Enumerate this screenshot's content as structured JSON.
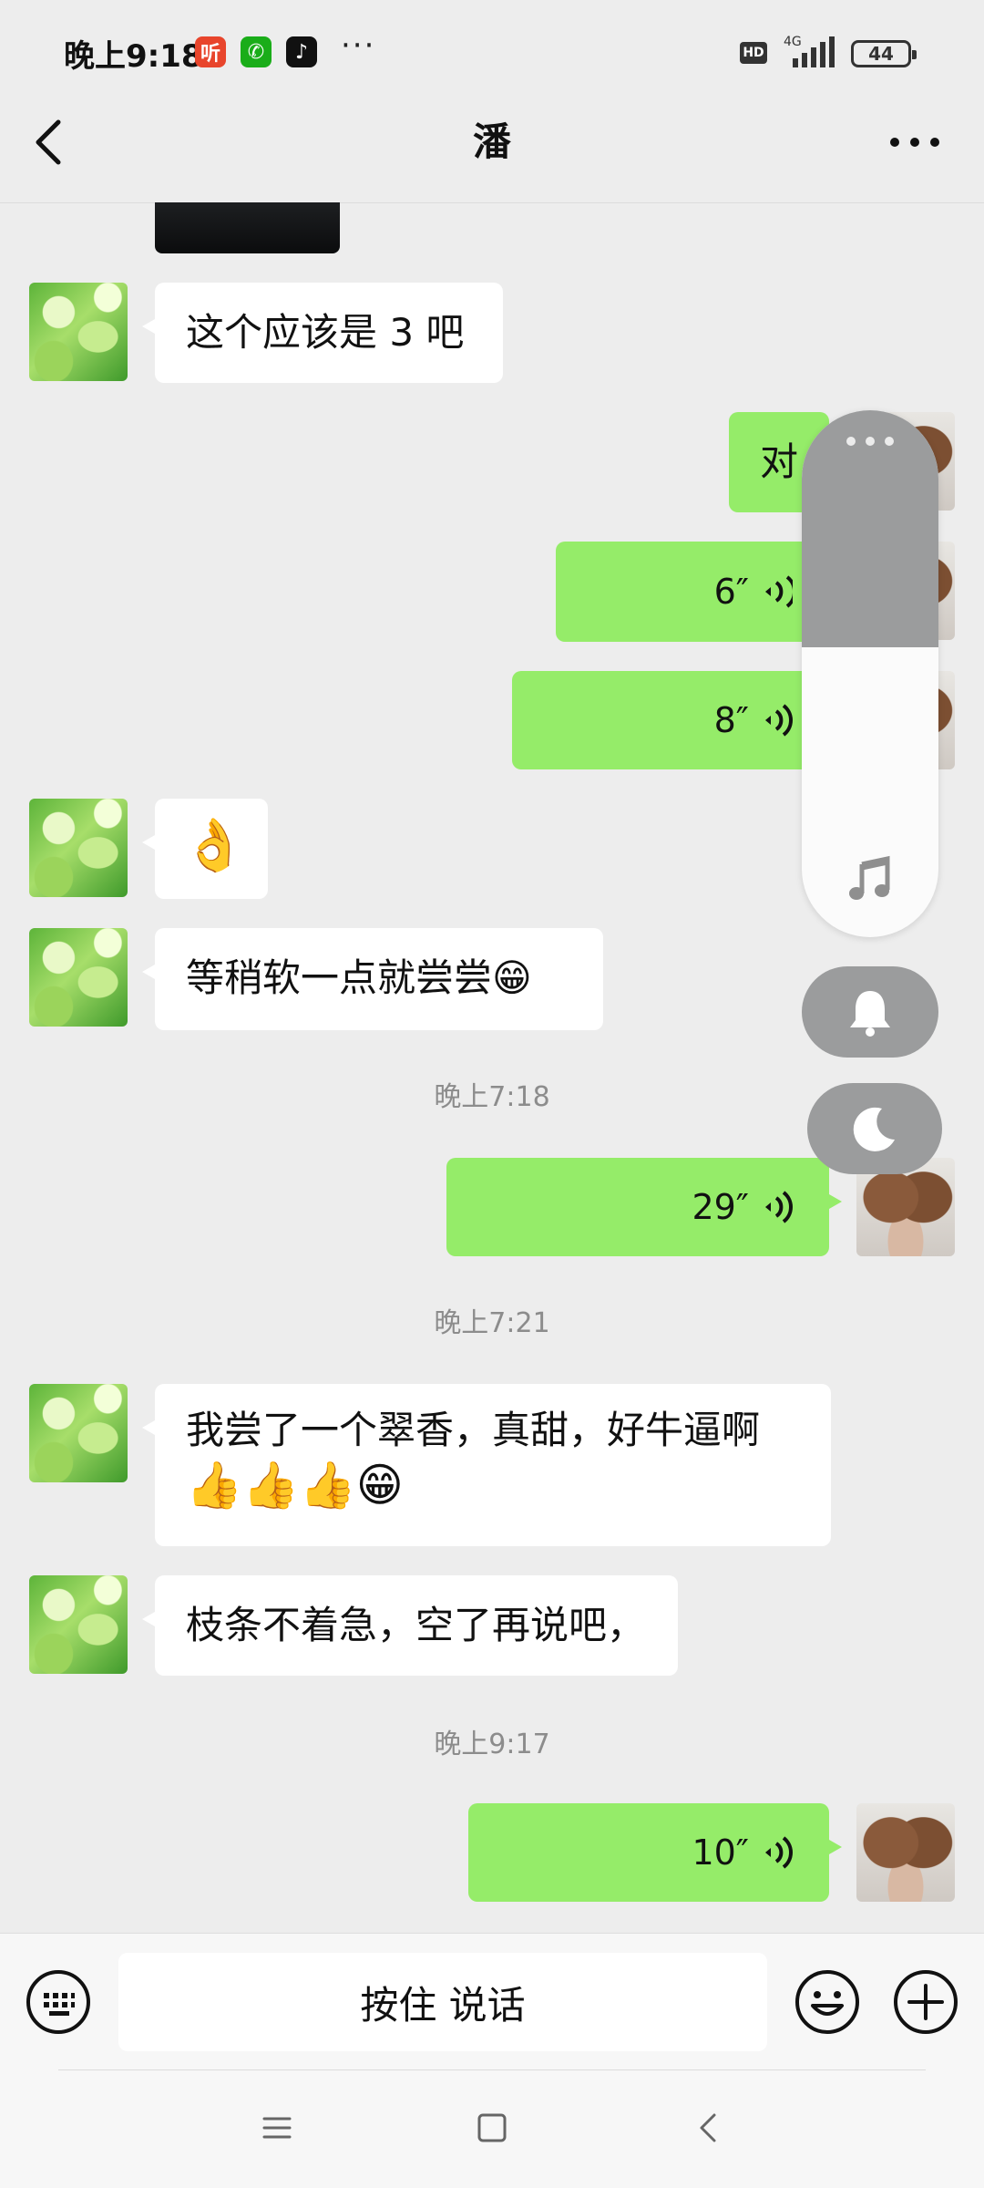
{
  "status_bar": {
    "time": "晚上9:18",
    "apps": [
      {
        "icon": "ximalaya-app-icon",
        "glyph": "听",
        "color": "#e8452c"
      },
      {
        "icon": "wechat-app-icon",
        "glyph": "✆",
        "color": "#1aad19"
      },
      {
        "icon": "douyin-app-icon",
        "glyph": "♪",
        "color": "#111111"
      }
    ],
    "more": "···",
    "hd": "HD",
    "network": "4G",
    "battery": "44"
  },
  "header": {
    "title": "潘"
  },
  "messages": [
    {
      "side": "left",
      "type": "text",
      "text": "这个应该是 3 吧"
    },
    {
      "side": "right",
      "type": "text",
      "text": "对"
    },
    {
      "side": "right",
      "type": "voice",
      "duration": "6″"
    },
    {
      "side": "right",
      "type": "voice",
      "duration": "8″"
    },
    {
      "side": "left",
      "type": "emoji",
      "text": "👌"
    },
    {
      "side": "left",
      "type": "text",
      "text": "等稍软一点就尝尝😁"
    },
    {
      "type": "time",
      "text": "晚上7:18"
    },
    {
      "side": "right",
      "type": "voice",
      "duration": "29″"
    },
    {
      "type": "time",
      "text": "晚上7:21"
    },
    {
      "side": "left",
      "type": "text",
      "line1": "我尝了一个翠香，真甜，好牛逼啊",
      "line2": "👍👍👍😁"
    },
    {
      "side": "left",
      "type": "text",
      "text": "枝条不着急，空了再说吧，"
    },
    {
      "type": "time",
      "text": "晚上9:17"
    },
    {
      "side": "right",
      "type": "voice",
      "duration": "10″"
    }
  ],
  "input_bar": {
    "hold_to_talk": "按住 说话"
  },
  "volume_panel": {
    "level": 0.55
  }
}
